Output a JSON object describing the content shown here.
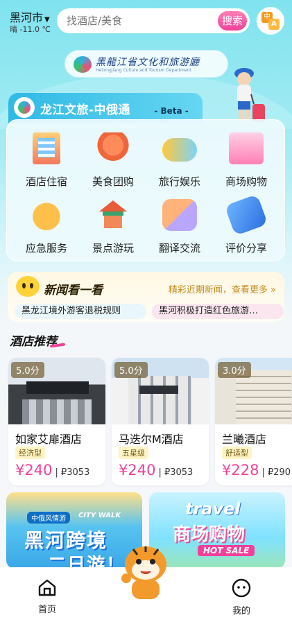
{
  "header": {
    "city": "黑河市",
    "weather": "晴 -11.0 ℃",
    "search_placeholder": "找酒店/美食",
    "search_button": "搜索",
    "translate_zh": "中",
    "translate_a": "A"
  },
  "banner": {
    "logo_text": "黑龍江省文化和旅游廳",
    "logo_sub": "Heilongjiang Culture and Tourism Department"
  },
  "services": {
    "title": "龙江文旅-中俄通",
    "beta": "- Beta -",
    "items": [
      {
        "label": "酒店住宿",
        "icon": "hotel-building-icon"
      },
      {
        "label": "美食团购",
        "icon": "food-bowl-icon"
      },
      {
        "label": "旅行娱乐",
        "icon": "game-controller-icon"
      },
      {
        "label": "商场购物",
        "icon": "shopping-bag-icon"
      },
      {
        "label": "应急服务",
        "icon": "alarm-bell-icon"
      },
      {
        "label": "景点游玩",
        "icon": "pavilion-icon"
      },
      {
        "label": "翻译交流",
        "icon": "translate-bubble-icon"
      },
      {
        "label": "评价分享",
        "icon": "pencil-notebook-icon"
      }
    ]
  },
  "news": {
    "title": "新闻看一看",
    "more": "精彩近期新闻，查看更多 »",
    "items": [
      "黑龙江境外游客退税规则",
      "黑河积极打造红色旅游…"
    ]
  },
  "hotels": {
    "section_title": "酒店推荐",
    "items": [
      {
        "score": "5.0分",
        "name": "如家艾扉酒店",
        "badge": "经济型",
        "price": "¥240",
        "rub": "| ₽3053"
      },
      {
        "score": "5.0分",
        "name": "马迭尔M酒店",
        "badge": "五星级",
        "price": "¥240",
        "rub": "| ₽3053"
      },
      {
        "score": "3.0分",
        "name": "兰曦酒店",
        "badge": "舒适型",
        "price": "¥228",
        "rub": "| ₽290"
      }
    ]
  },
  "promos": {
    "a": {
      "tag": "中俄风情游",
      "cw": "CITY WALK",
      "line1": "黑河跨境",
      "line2": "二日游！"
    },
    "b": {
      "travel": "travel",
      "shop": "商场购物",
      "sale": "HOT SALE"
    }
  },
  "bottom_nav": {
    "home": "首页",
    "mine": "我的"
  },
  "colors": {
    "accent": "#f2409a",
    "teal": "#2fb9e5"
  }
}
